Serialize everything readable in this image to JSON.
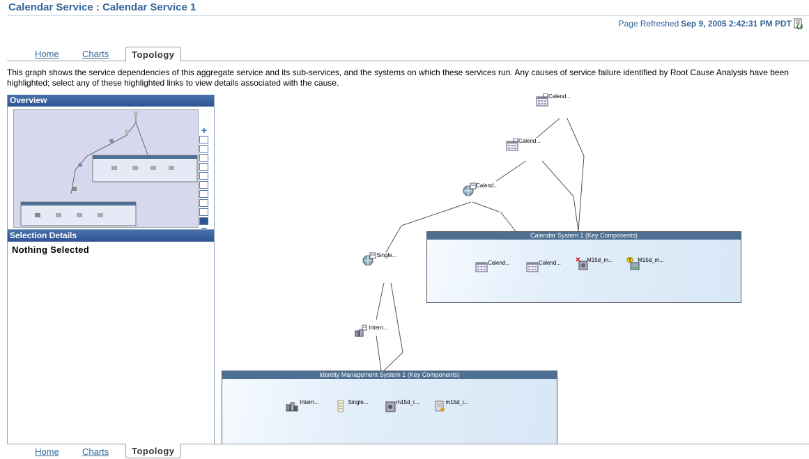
{
  "page": {
    "title": "Calendar Service : Calendar Service 1",
    "refresh_label": "Page Refreshed",
    "refresh_time": "Sep 9, 2005 2:42:31 PM PDT",
    "description": "This graph shows the service dependencies of this aggregate service and its sub-services, and the systems on which these services run. Any causes of service failure identified by Root Cause Analysis have been highlighted; select any of these highlighted links to view details associated with the cause."
  },
  "tabs": [
    {
      "label": "Home",
      "active": false
    },
    {
      "label": "Charts",
      "active": false
    },
    {
      "label": "Topology",
      "active": true
    }
  ],
  "left": {
    "overview_title": "Overview",
    "selection_title": "Selection Details",
    "selection_text": "Nothing Selected"
  },
  "graph": {
    "nodes": [
      {
        "label": "Calend...",
        "icon": "calendar-service-icon"
      },
      {
        "label": "Calend...",
        "icon": "calendar-service-icon"
      },
      {
        "label": "Calend...",
        "icon": "calendar-globe-service-icon"
      },
      {
        "label": "Single...",
        "icon": "single-signon-service-icon"
      },
      {
        "label": "Intern...",
        "icon": "internet-directory-service-icon"
      }
    ],
    "groups": [
      {
        "title": "Calendar System 1 (Key Components)",
        "members": [
          {
            "label": "Calend...",
            "icon": "calendar-server-icon"
          },
          {
            "label": "Calend...",
            "icon": "calendar-server-icon"
          },
          {
            "label": "M15d_m...",
            "icon": "server-down-icon"
          },
          {
            "label": "M15d_m...",
            "icon": "server-warning-icon"
          }
        ]
      },
      {
        "title": "Identity Management System 1 (Key Components)",
        "members": [
          {
            "label": "Intern...",
            "icon": "directory-server-icon"
          },
          {
            "label": "Single...",
            "icon": "sso-server-icon"
          },
          {
            "label": "m15d_i...",
            "icon": "application-server-icon"
          },
          {
            "label": "m15d_i...",
            "icon": "database-icon"
          }
        ]
      }
    ]
  },
  "colors": {
    "title": "#336699",
    "panel_header": "#2d5594",
    "group_header": "#4d6f91",
    "overview_bg": "#d7d8ee"
  }
}
